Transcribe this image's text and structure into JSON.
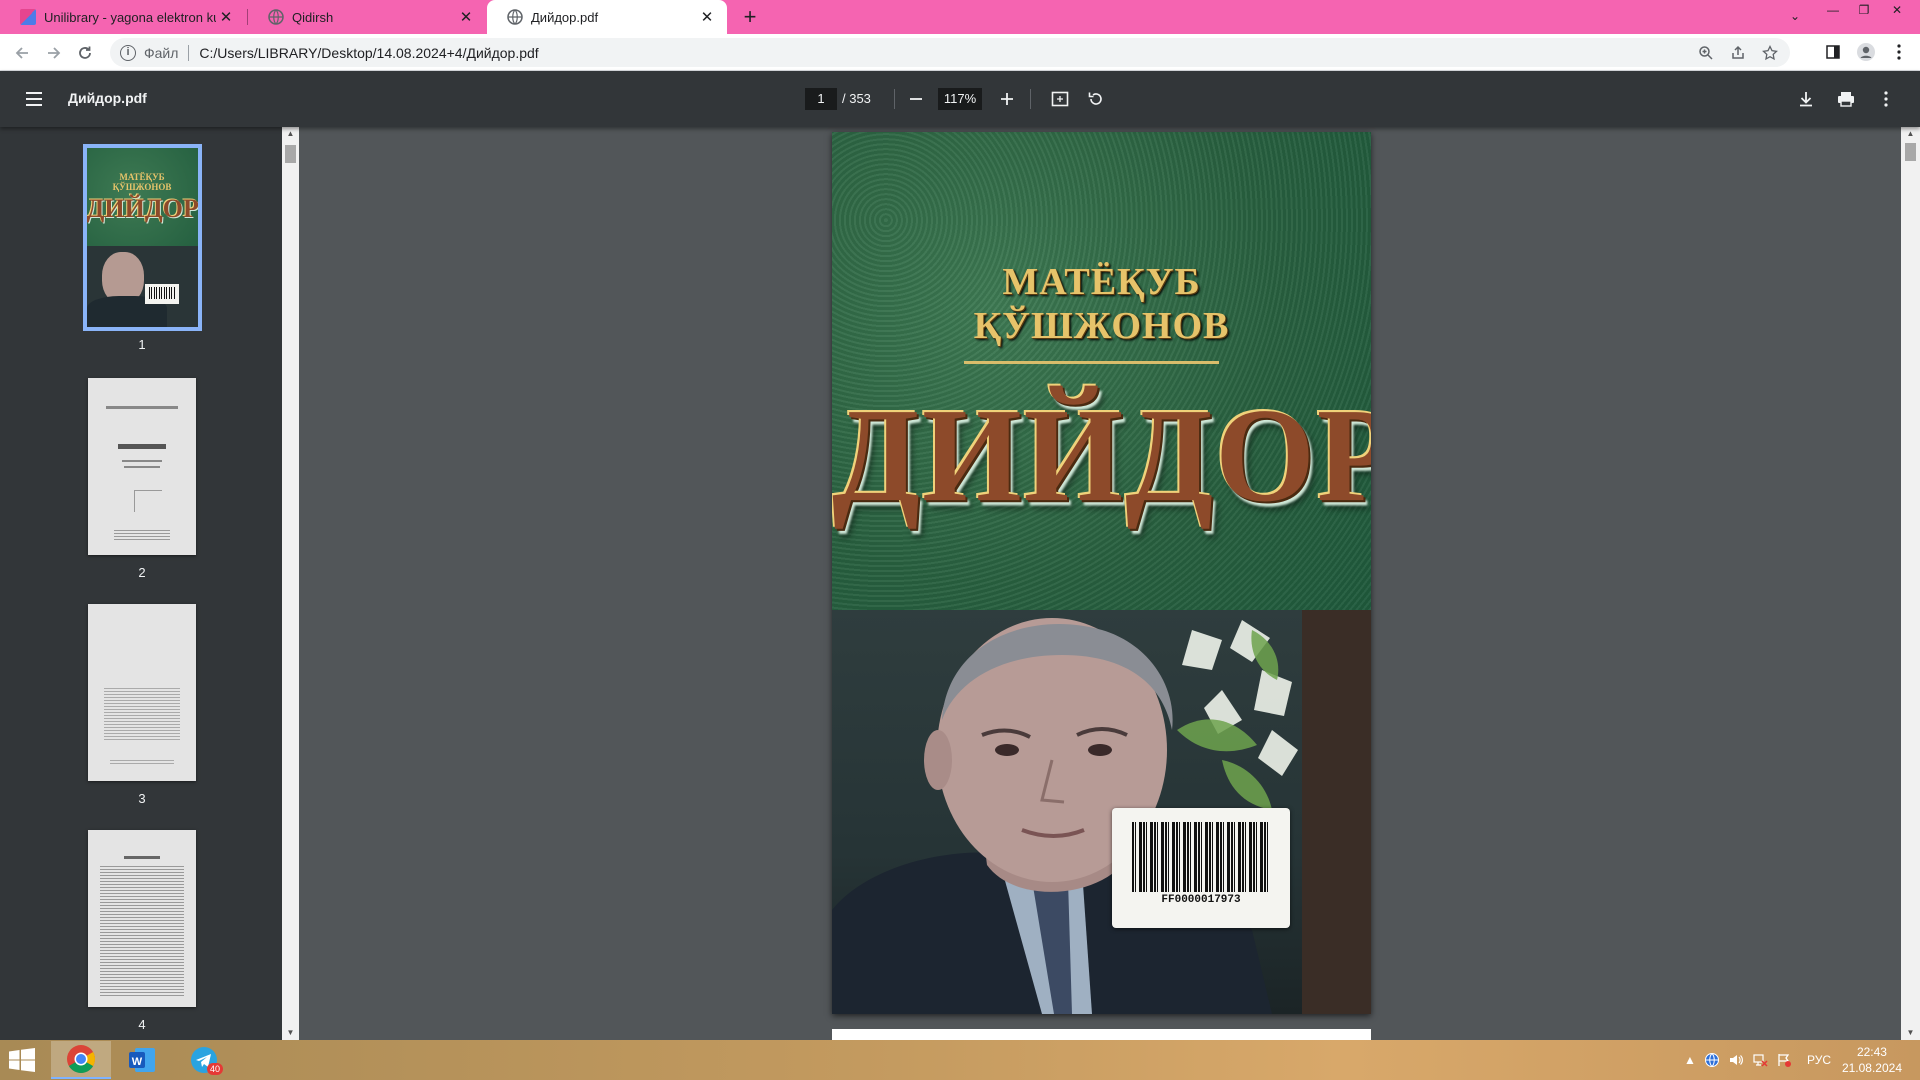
{
  "browser": {
    "tabs": [
      {
        "title": "Unilibrary - yagona elektron kutubxona",
        "favicon": "book-icon",
        "active": false
      },
      {
        "title": "Qidirsh",
        "favicon": "globe-icon",
        "active": false
      },
      {
        "title": "Дийдор.pdf",
        "favicon": "globe-icon",
        "active": true
      }
    ],
    "address": {
      "scheme_label": "Файл",
      "url": "C:/Users/LIBRARY/Desktop/14.08.2024+4/Дийдор.pdf"
    }
  },
  "pdf": {
    "file_title": "Дийдор.pdf",
    "current_page": "1",
    "total_pages": "/ 353",
    "zoom": "117%",
    "thumbnails": [
      {
        "number": "1",
        "selected": true
      },
      {
        "number": "2",
        "selected": false
      },
      {
        "number": "3",
        "selected": false
      },
      {
        "number": "4",
        "selected": false
      }
    ],
    "cover": {
      "author_line1": "МАТЁҚУБ",
      "author_line2": "ҚЎШЖОНОВ",
      "title": "ДИЙДОР",
      "barcode": "FF0000017973"
    }
  },
  "taskbar": {
    "apps": [
      "chrome-icon",
      "word-icon",
      "telegram-icon"
    ],
    "telegram_badge": "40",
    "language": "РУС",
    "time": "22:43",
    "date": "21.08.2024"
  },
  "colors": {
    "tabstrip": "#f564b1",
    "pdf_toolbar": "#323639",
    "viewer_bg": "#525659",
    "selection": "#8ab4f8"
  }
}
